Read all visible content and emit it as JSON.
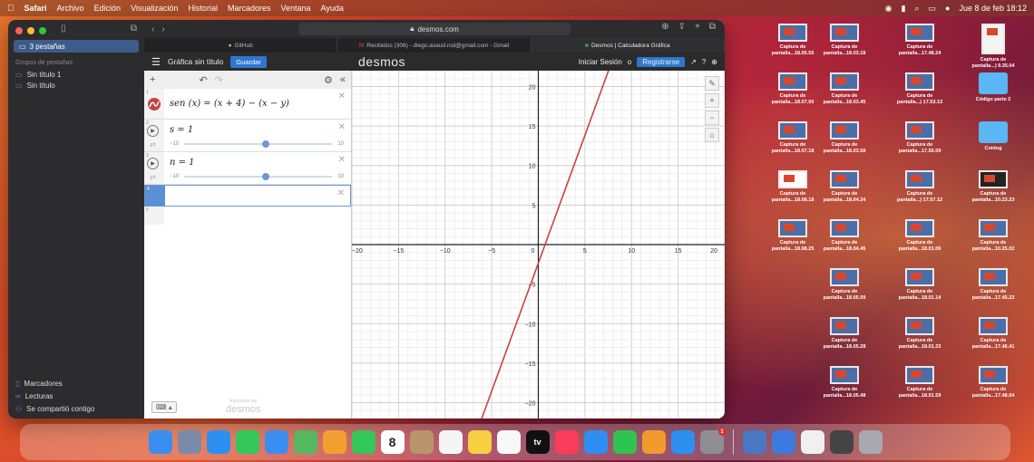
{
  "menubar": {
    "app": "Safari",
    "menus": [
      "Archivo",
      "Edición",
      "Visualización",
      "Historial",
      "Marcadores",
      "Ventana",
      "Ayuda"
    ],
    "datetime": "Jue 8 de feb  18:12"
  },
  "sidebar": {
    "tabs_label": "3 pestañas",
    "section_label": "Grupos de pestañas",
    "items": [
      "Sin título 1",
      "Sin título"
    ],
    "bottom": [
      "Marcadores",
      "Lecturas",
      "Se compartió contigo"
    ]
  },
  "browser": {
    "url": "desmos.com",
    "tabs": [
      "GitHub",
      "Recibidos (306) - diego.asaud.rod@gmail.com - Gmail",
      "Desmos | Calculadora Gráfica"
    ]
  },
  "desmos": {
    "title": "Gráfica sin título",
    "save": "Guardar",
    "logo": "desmos",
    "login": "Iniciar Sesión",
    "or": "o",
    "register": "Registrarse",
    "expressions": [
      {
        "index": "1",
        "latex": "sen (x)  = (x + 4) − (x − y)"
      },
      {
        "index": "2",
        "latex": "s = 1",
        "min": "−10",
        "max": "10",
        "value": 1
      },
      {
        "index": "3",
        "latex": "n = 1",
        "min": "−10",
        "max": "10",
        "value": 1
      },
      {
        "index": "4",
        "latex": ""
      },
      {
        "index": "5",
        "latex": ""
      }
    ],
    "powered_small": "impulsado por",
    "powered_logo": "desmos"
  },
  "chart_data": {
    "type": "line",
    "xlim": [
      -20,
      20
    ],
    "ylim": [
      -22,
      22
    ],
    "x_ticks": [
      -20,
      -15,
      -10,
      -5,
      0,
      5,
      10,
      15,
      20
    ],
    "y_ticks": [
      20,
      15,
      10,
      5,
      -5,
      -10,
      -15,
      -20
    ],
    "grid": true,
    "series": [
      {
        "x": [
          -7,
          10
        ],
        "y": [
          -25,
          30
        ],
        "color": "#c74440"
      }
    ]
  },
  "desktop": {
    "items": [
      [
        "Captura de",
        "pantalla...18.05.55"
      ],
      [
        "Captura de",
        "pantalla...18.03.18"
      ],
      [
        "Captura de",
        "pantalla...17.48.24"
      ],
      [
        "Captura de",
        "pantalla...) 9.35.04"
      ],
      [
        "Captura de",
        "pantalla...18.07.00"
      ],
      [
        "Captura de",
        "pantalla...18.03.45"
      ],
      [
        "Captura de",
        "pantalla...) 17.53.13"
      ],
      [
        "Código parte 2",
        ""
      ],
      [
        "Captura de",
        "pantalla...18.07.18"
      ],
      [
        "Captura de",
        "pantalla...18.03.58"
      ],
      [
        "Captura de",
        "pantalla...17.55.09"
      ],
      [
        "Coidog",
        ""
      ],
      [
        "Captura de",
        "pantalla...18.08.18"
      ],
      [
        "Captura de",
        "pantalla...18.04.34"
      ],
      [
        "Captura de",
        "pantalla...) 17.57.12"
      ],
      [
        "Captura de",
        "pantalla...10.23.23"
      ],
      [
        "Captura de",
        "pantalla...18.08.25"
      ],
      [
        "Captura de",
        "pantalla...18.04.45"
      ],
      [
        "Captura de",
        "pantalla...18.01.06"
      ],
      [
        "Captura de",
        "pantalla...10.25.02"
      ],
      [
        "",
        ""
      ],
      [
        "Captura de",
        "pantalla...18.05.09"
      ],
      [
        "Captura de",
        "pantalla...18.01.14"
      ],
      [
        "Captura de",
        "pantalla...17.45.22"
      ],
      [
        "",
        ""
      ],
      [
        "Captura de",
        "pantalla...18.05.28"
      ],
      [
        "Captura de",
        "pantalla...18.01.33"
      ],
      [
        "Captura de",
        "pantalla...17.46.41"
      ],
      [
        "",
        ""
      ],
      [
        "Captura de",
        "pantalla...18.05.48"
      ],
      [
        "Captura de",
        "pantalla...18.01.59"
      ],
      [
        "Captura de",
        "pantalla...17.48.04"
      ]
    ]
  },
  "dock": {
    "calendar_day": "8",
    "tv_label": "tv",
    "apps": [
      {
        "name": "finder-icon",
        "color": "#3a8ef0"
      },
      {
        "name": "launchpad-icon",
        "color": "#7a8aa8"
      },
      {
        "name": "safari-icon",
        "color": "#2d8ff0"
      },
      {
        "name": "messages-icon",
        "color": "#35c759"
      },
      {
        "name": "mail-icon",
        "color": "#3b8ef0"
      },
      {
        "name": "maps-icon",
        "color": "#55b860"
      },
      {
        "name": "photos-icon",
        "color": "#f0a030"
      },
      {
        "name": "facetime-icon",
        "color": "#34c759"
      },
      {
        "name": "calendar-icon",
        "color": "#ffffff"
      },
      {
        "name": "contacts-icon",
        "color": "#b8956a"
      },
      {
        "name": "reminders-icon",
        "color": "#f5f5f5"
      },
      {
        "name": "notes-icon",
        "color": "#f5d042"
      },
      {
        "name": "freeform-icon",
        "color": "#f8f8f8"
      },
      {
        "name": "tv-icon",
        "color": "#111111"
      },
      {
        "name": "music-icon",
        "color": "#fa3c5a"
      },
      {
        "name": "keynote-icon",
        "color": "#2f8ef4"
      },
      {
        "name": "numbers-icon",
        "color": "#30c352"
      },
      {
        "name": "pages-icon",
        "color": "#f29a2e"
      },
      {
        "name": "app-store-icon",
        "color": "#2d8ff0"
      },
      {
        "name": "settings-icon",
        "color": "#8e8e93"
      },
      {
        "name": "preview-icon",
        "color": "#4a78c0"
      },
      {
        "name": "xcode-icon",
        "color": "#3c7ae0"
      },
      {
        "name": "document-icon",
        "color": "#f0f0f0"
      },
      {
        "name": "downloads-stack-icon",
        "color": "#444444"
      },
      {
        "name": "trash-icon",
        "color": "#a8a8b0"
      }
    ]
  }
}
